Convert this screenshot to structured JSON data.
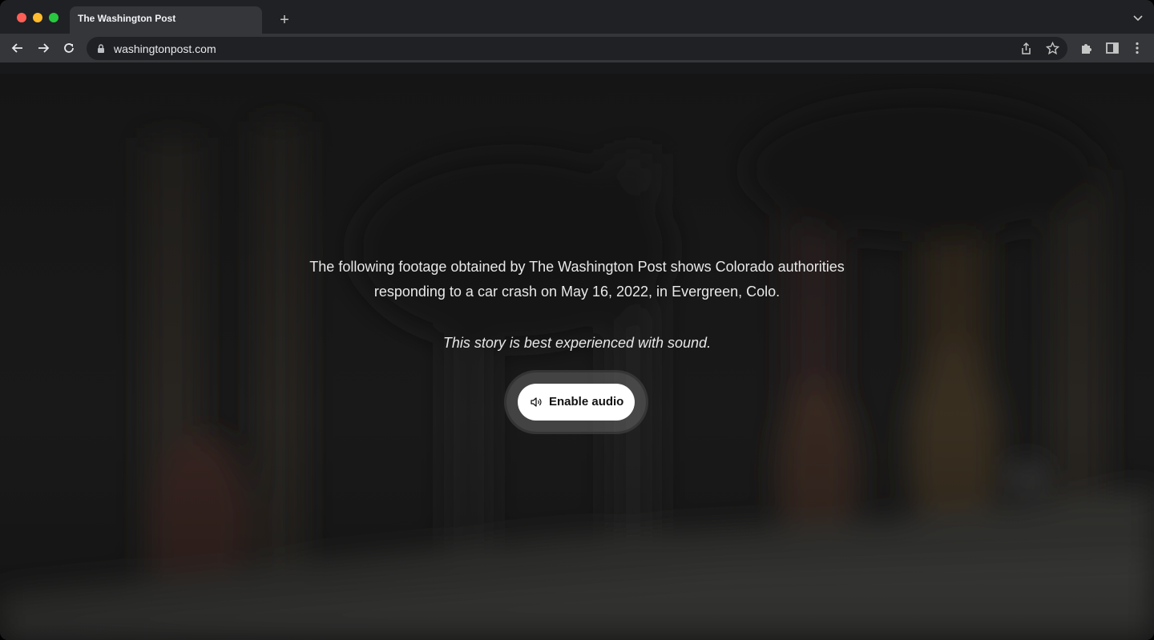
{
  "browser": {
    "tab_title": "The Washington Post",
    "new_tab_symbol": "+",
    "url": "washingtonpost.com",
    "icons": [
      "back-icon",
      "forward-icon",
      "reload-icon",
      "lock-icon",
      "share-icon",
      "bookmark-star-icon",
      "extensions-icon",
      "side-panel-icon",
      "more-menu-icon",
      "tab-list-chevron-icon"
    ]
  },
  "story": {
    "caption": "The following footage obtained by The Washington Post shows Colorado authorities responding to a car crash on May 16, 2022, in Evergreen, Colo.",
    "hint": "This story is best experienced with sound.",
    "enable_audio_label": "Enable audio",
    "enable_audio_icon": "speaker-icon"
  },
  "colors": {
    "tabstrip_bg": "#202124",
    "toolbar_bg": "#35363a",
    "page_bg": "#1b1b1b",
    "button_bg": "#ffffff"
  }
}
